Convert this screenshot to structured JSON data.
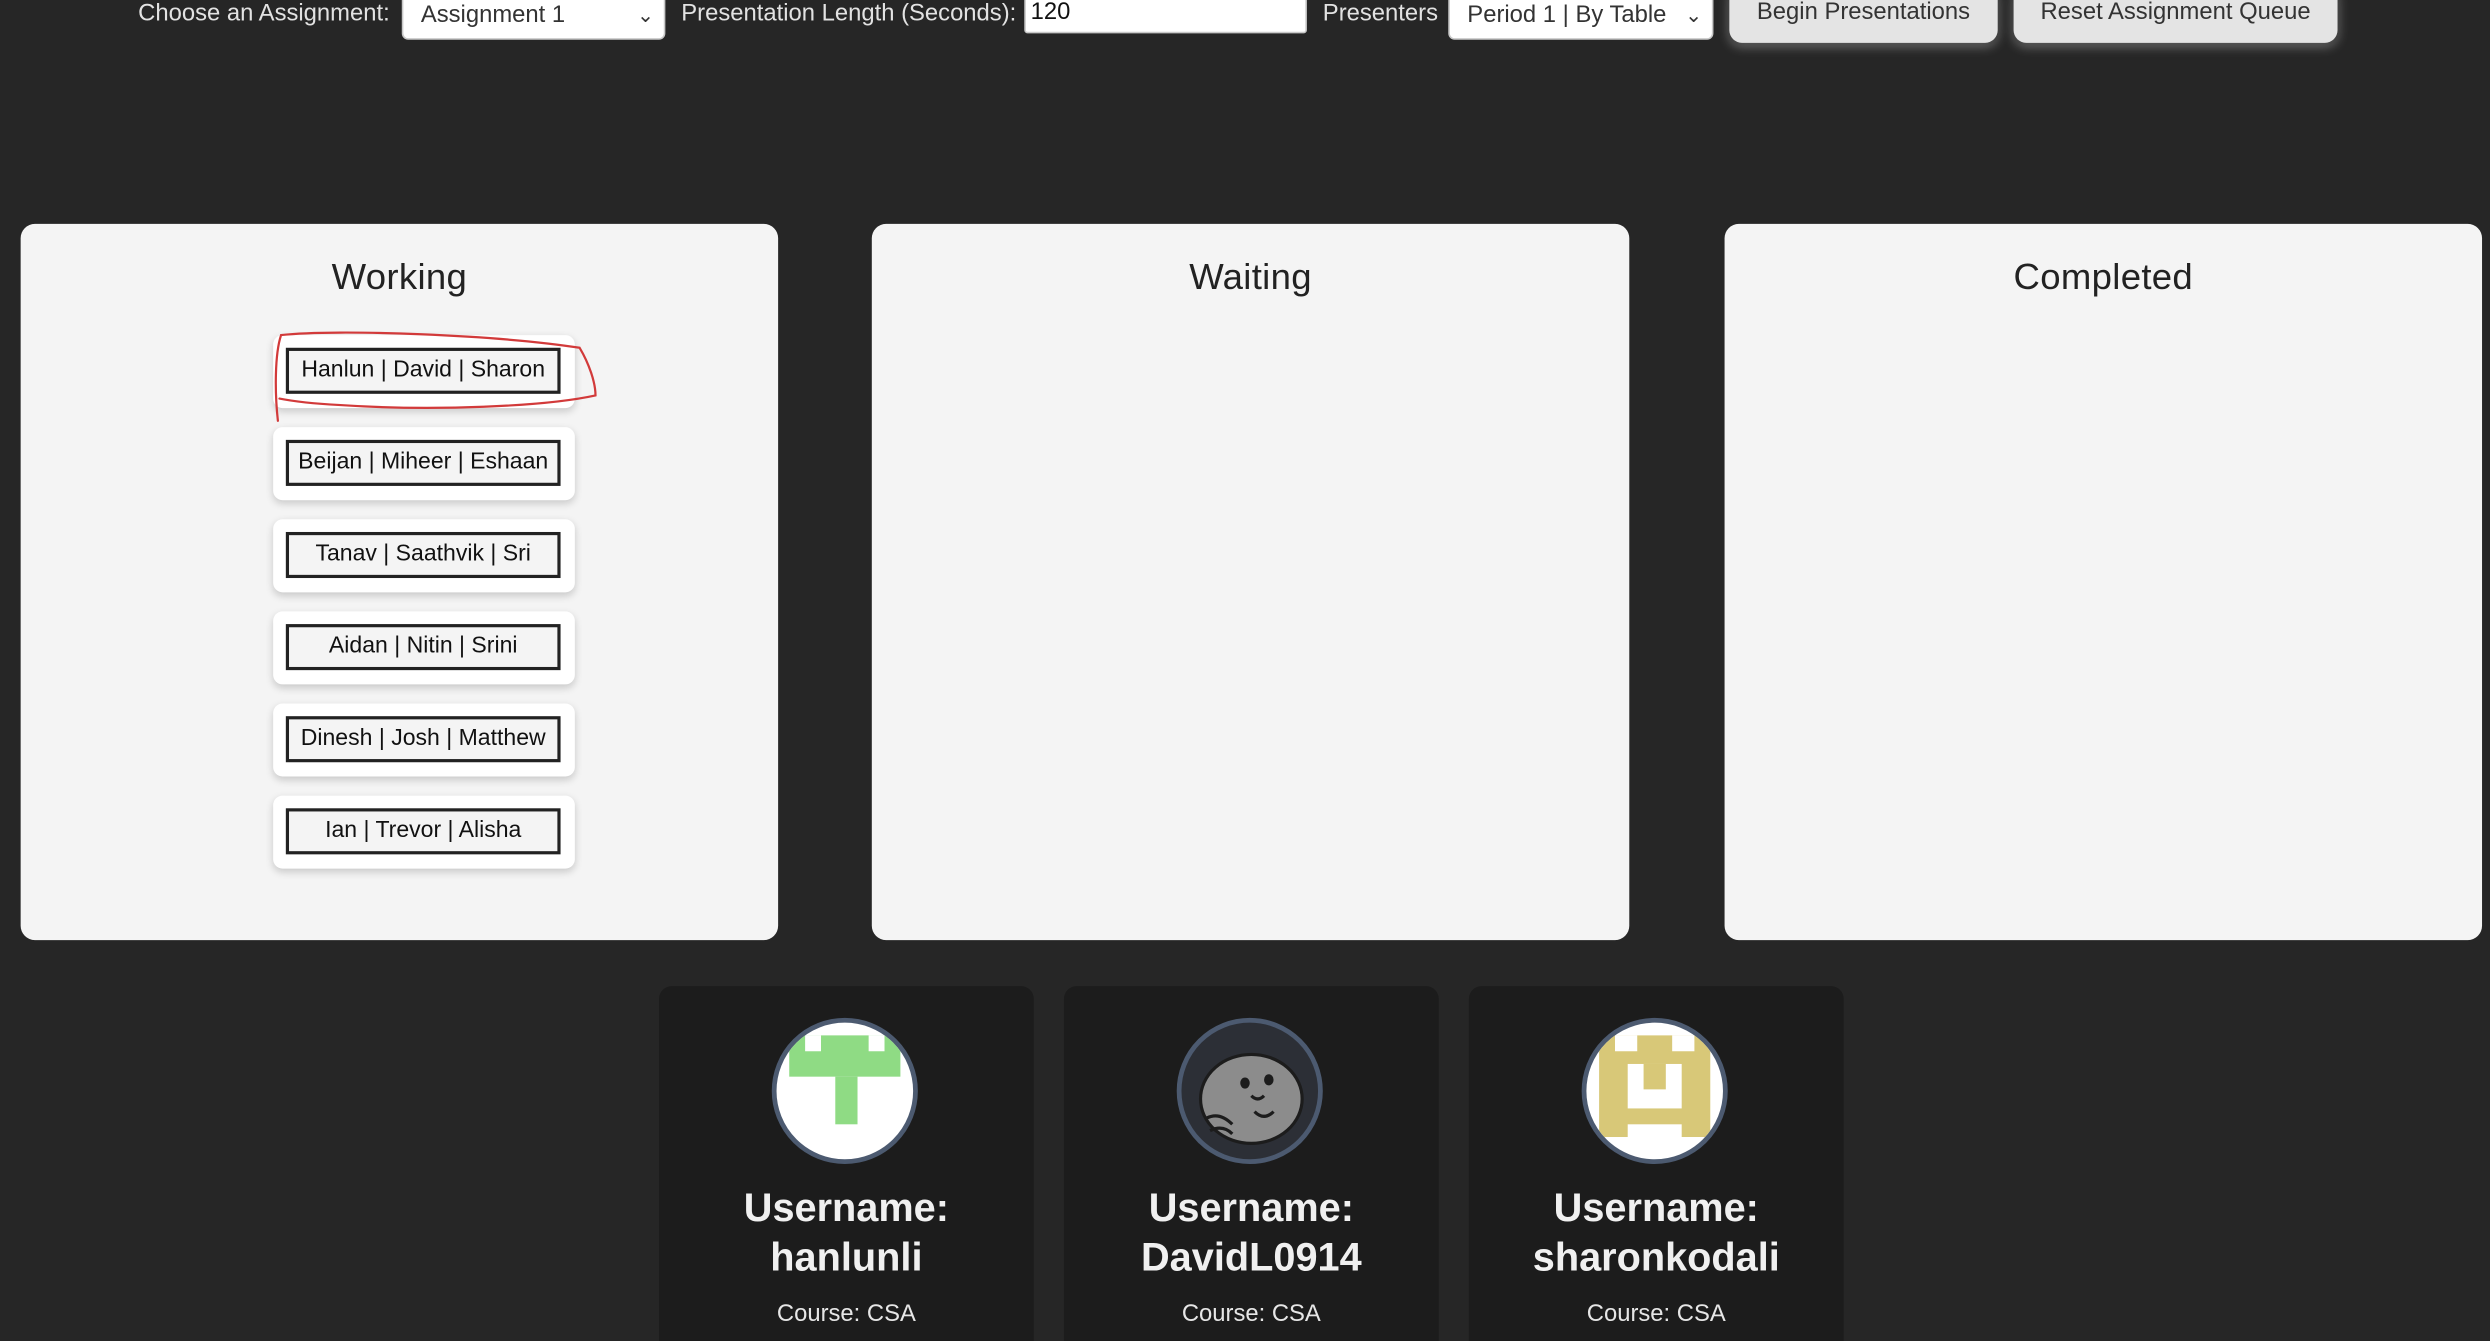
{
  "toolbar": {
    "assignment_label": "Choose an Assignment:",
    "assignment_value": "Assignment 1",
    "length_label": "Presentation Length (Seconds):",
    "length_value": "120",
    "presenters_label": "Presenters",
    "presenters_value": "Period 1 | By Table",
    "begin_button": "Begin Presentations",
    "reset_button": "Reset Assignment Queue"
  },
  "columns": {
    "working": {
      "title": "Working",
      "groups": [
        "Hanlun | David | Sharon",
        "Beijan | Miheer | Eshaan",
        "Tanav | Saathvik | Sri",
        "Aidan | Nitin | Srini",
        "Dinesh | Josh | Matthew",
        "Ian | Trevor | Alisha"
      ]
    },
    "waiting": {
      "title": "Waiting",
      "groups": []
    },
    "completed": {
      "title": "Completed",
      "groups": []
    }
  },
  "profiles": [
    {
      "username_label": "Username:",
      "username": "hanlunli",
      "course": "Course: CSA",
      "avatar_icon": "green-pixel-avatar-icon",
      "avatar_color": "#8fdb84"
    },
    {
      "username_label": "Username:",
      "username": "DavidL0914",
      "course": "Course: CSA",
      "avatar_icon": "seal-avatar-icon",
      "avatar_color": "#3a3a3a"
    },
    {
      "username_label": "Username:",
      "username": "sharonkodali",
      "course": "Course: CSA",
      "avatar_icon": "yellow-pixel-avatar-icon",
      "avatar_color": "#d8c878"
    }
  ],
  "colors": {
    "page_background": "#262626",
    "column_background": "#f4f4f4",
    "profile_card_background": "#1c1c1c",
    "highlight_annotation": "#d23a3a"
  }
}
